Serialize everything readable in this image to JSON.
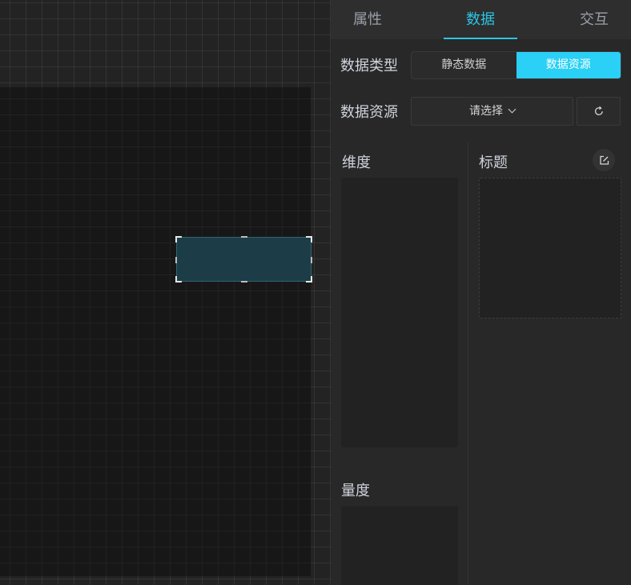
{
  "tabs": {
    "properties": "属性",
    "data": "数据",
    "interaction": "交互",
    "active": "数据"
  },
  "data_type": {
    "label": "数据类型",
    "options": [
      "静态数据",
      "数据资源"
    ],
    "selected": "数据资源"
  },
  "data_source": {
    "label": "数据资源",
    "placeholder": "请选择",
    "refresh_icon": "refresh-icon"
  },
  "fields": {
    "dimension_label": "维度",
    "measure_label": "量度",
    "title_label": "标题",
    "edit_icon": "edit-icon"
  },
  "colors": {
    "accent": "#2ac6e6",
    "active_button": "#2ad0f5",
    "widget_fill": "#1c3d47"
  }
}
